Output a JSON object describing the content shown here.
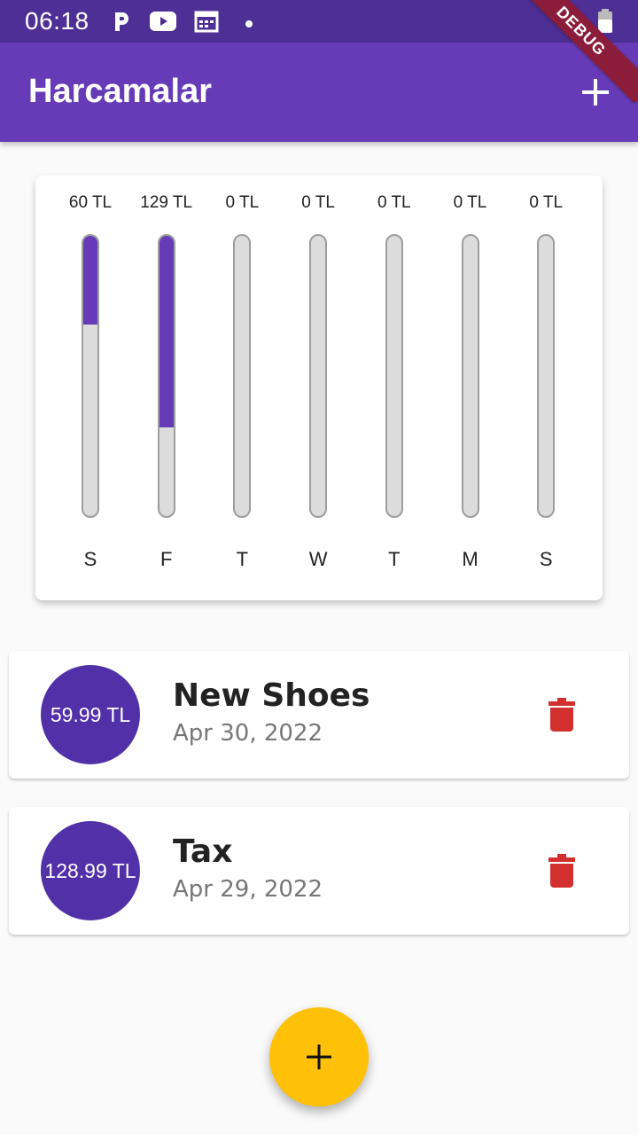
{
  "status_bar": {
    "time": "06:18",
    "icons": [
      "parking-app-icon",
      "youtube-icon",
      "calendar-icon",
      "dot-icon",
      "wifi-icon",
      "battery-icon"
    ],
    "debug_label": "DEBUG"
  },
  "app_bar": {
    "title": "Harcamalar",
    "add_icon": "plus-icon"
  },
  "colors": {
    "primary": "#673ab7",
    "avatar": "#5130a8",
    "accent": "#ffc107",
    "delete": "#d32f2f"
  },
  "chart_data": {
    "type": "bar",
    "categories": [
      "S",
      "F",
      "T",
      "W",
      "T",
      "M",
      "S"
    ],
    "labels": [
      "60 TL",
      "129 TL",
      "0 TL",
      "0 TL",
      "0 TL",
      "0 TL",
      "0 TL"
    ],
    "values": [
      60,
      129,
      0,
      0,
      0,
      0,
      0
    ],
    "fill_fraction": [
      0.317,
      0.683,
      0,
      0,
      0,
      0,
      0
    ]
  },
  "transactions": [
    {
      "amount": "59.99 TL",
      "title": "New Shoes",
      "date": "Apr 30, 2022",
      "delete_icon": "trash-icon"
    },
    {
      "amount": "128.99 TL",
      "title": "Tax",
      "date": "Apr 29, 2022",
      "delete_icon": "trash-icon"
    }
  ],
  "fab": {
    "icon": "plus-icon"
  }
}
